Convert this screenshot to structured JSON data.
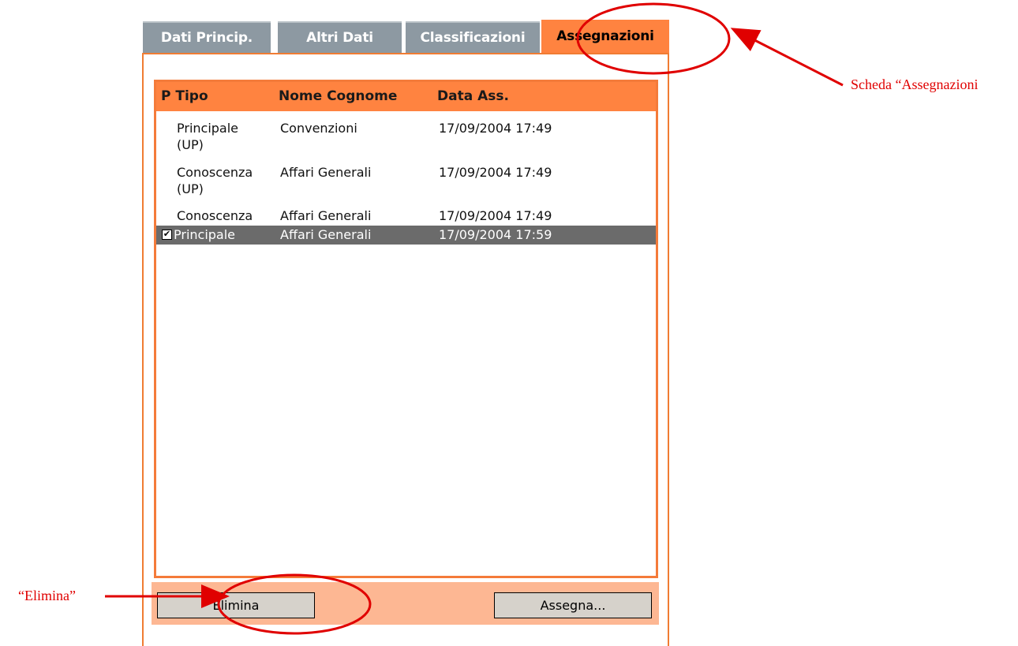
{
  "tabs": [
    {
      "label": "Dati Princip."
    },
    {
      "label": "Altri Dati"
    },
    {
      "label": "Classificazioni"
    },
    {
      "label": "Assegnazioni"
    }
  ],
  "list": {
    "columns": [
      "P Tipo",
      "Nome Cognome",
      "Data Ass."
    ],
    "rows": [
      {
        "tipo": "Principale\n(UP)",
        "nome": "Convenzioni",
        "data": "17/09/2004 17:49",
        "checked": false,
        "selected": false
      },
      {
        "tipo": "Conoscenza\n(UP)",
        "nome": "Affari Generali",
        "data": "17/09/2004 17:49",
        "checked": false,
        "selected": false
      },
      {
        "tipo": "Conoscenza",
        "nome": "Affari Generali",
        "data": "17/09/2004 17:49",
        "checked": false,
        "selected": false
      },
      {
        "tipo": "Principale",
        "nome": "Affari Generali",
        "data": "17/09/2004 17:59",
        "checked": true,
        "selected": true
      }
    ]
  },
  "buttons": {
    "elimina": "Elimina",
    "assegna": "Assegna..."
  },
  "annotations": {
    "scheda_label": "Scheda “Assegnazioni",
    "elimina_label": "“Elimina”",
    "color": "#e00000"
  },
  "colors": {
    "accent": "#ff8340",
    "tab_inactive": "#8d99a2",
    "selection": "#6b6b6b"
  }
}
